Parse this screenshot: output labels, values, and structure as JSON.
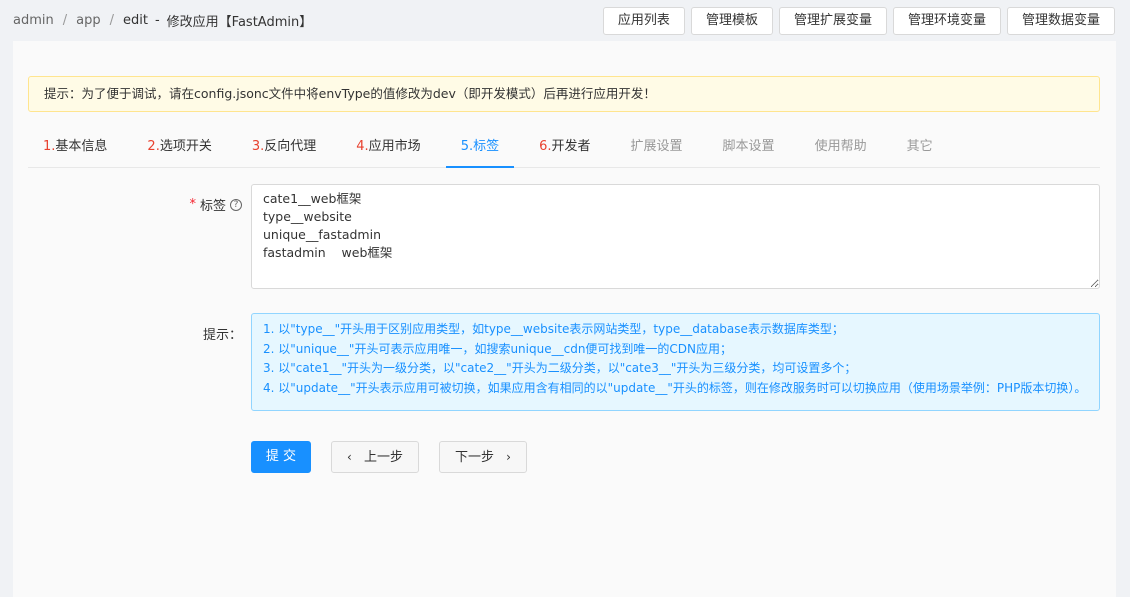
{
  "breadcrumb": {
    "items": [
      "admin",
      "app",
      "edit"
    ],
    "dash": "-",
    "current": "修改应用【FastAdmin】"
  },
  "top_buttons": [
    "应用列表",
    "管理模板",
    "管理扩展变量",
    "管理环境变量",
    "管理数据变量"
  ],
  "alert": "提示：为了便于调试，请在config.jsonc文件中将envType的值修改为dev（即开发模式）后再进行应用开发！",
  "tabs": [
    {
      "num": "1.",
      "label": "基本信息"
    },
    {
      "num": "2.",
      "label": "选项开关"
    },
    {
      "num": "3.",
      "label": "反向代理"
    },
    {
      "num": "4.",
      "label": "应用市场"
    },
    {
      "num": "5.",
      "label": "标签"
    },
    {
      "num": "6.",
      "label": "开发者"
    },
    {
      "label": "扩展设置"
    },
    {
      "label": "脚本设置"
    },
    {
      "label": "使用帮助"
    },
    {
      "label": "其它"
    }
  ],
  "form": {
    "tags_label": "标签",
    "required_mark": "*",
    "help_glyph": "?",
    "tags_value": "cate1__web框架\ntype__website\nunique__fastadmin\nfastadmin    web框架",
    "tips_label": "提示：",
    "tips": [
      "1. 以\"type__\"开头用于区别应用类型，如type__website表示网站类型，type__database表示数据库类型；",
      "2. 以\"unique__\"开头可表示应用唯一，如搜索unique__cdn便可找到唯一的CDN应用；",
      "3. 以\"cate1__\"开头为一级分类，以\"cate2__\"开头为二级分类，以\"cate3__\"开头为三级分类，均可设置多个；",
      "4. 以\"update__\"开头表示应用可被切换，如果应用含有相同的以\"update__\"开头的标签，则在修改服务时可以切换应用（使用场景举例：PHP版本切换）。"
    ]
  },
  "buttons": {
    "submit": "提 交",
    "prev": "上一步",
    "next": "下一步",
    "prev_glyph": "‹",
    "next_glyph": "›"
  }
}
